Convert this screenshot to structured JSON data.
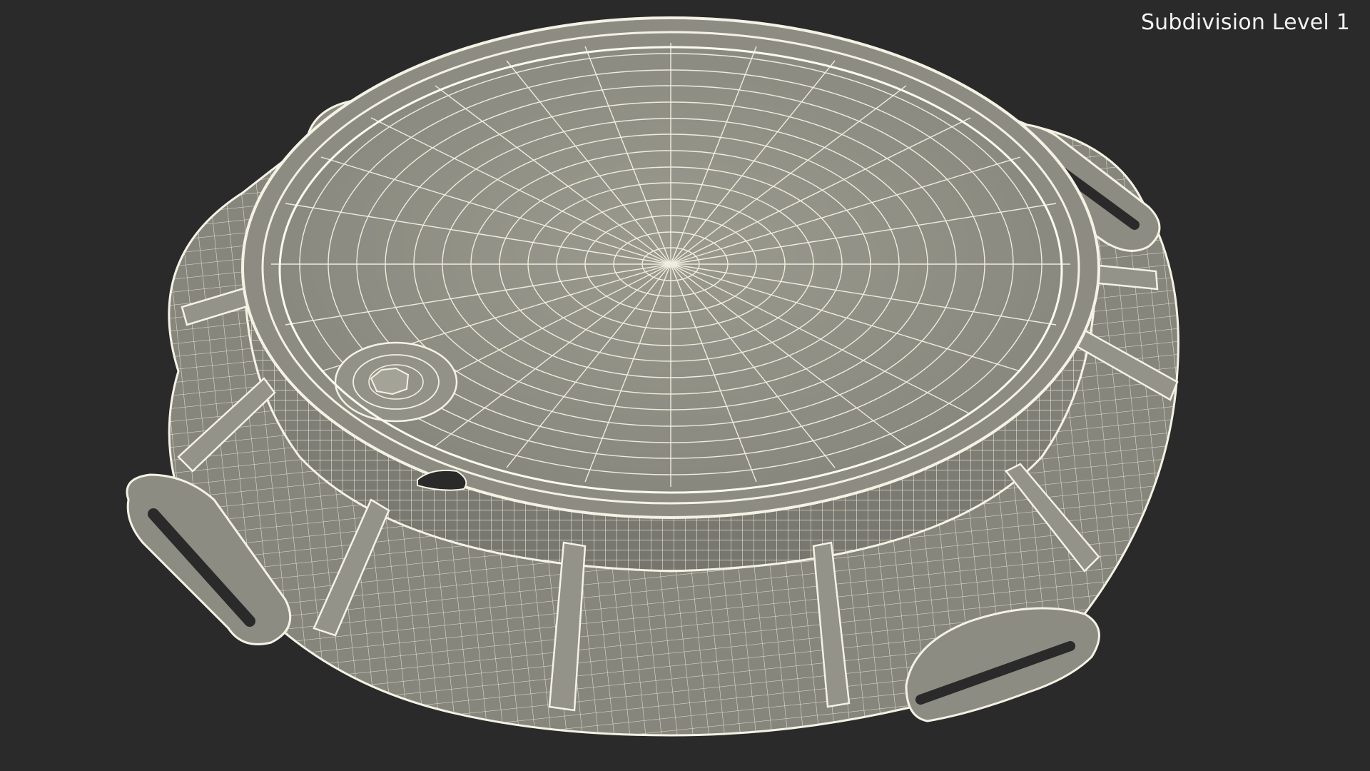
{
  "viewport": {
    "label": "Subdivision Level 1"
  },
  "model": {
    "name": "manhole-cover-wireframe",
    "render_mode": "wireframe",
    "colors": {
      "background": "#2a2a2a",
      "surface": "#8f8f84",
      "surface_light": "#a2a296",
      "surface_dark": "#6e6e66",
      "wire": "#f4f2e4"
    }
  }
}
